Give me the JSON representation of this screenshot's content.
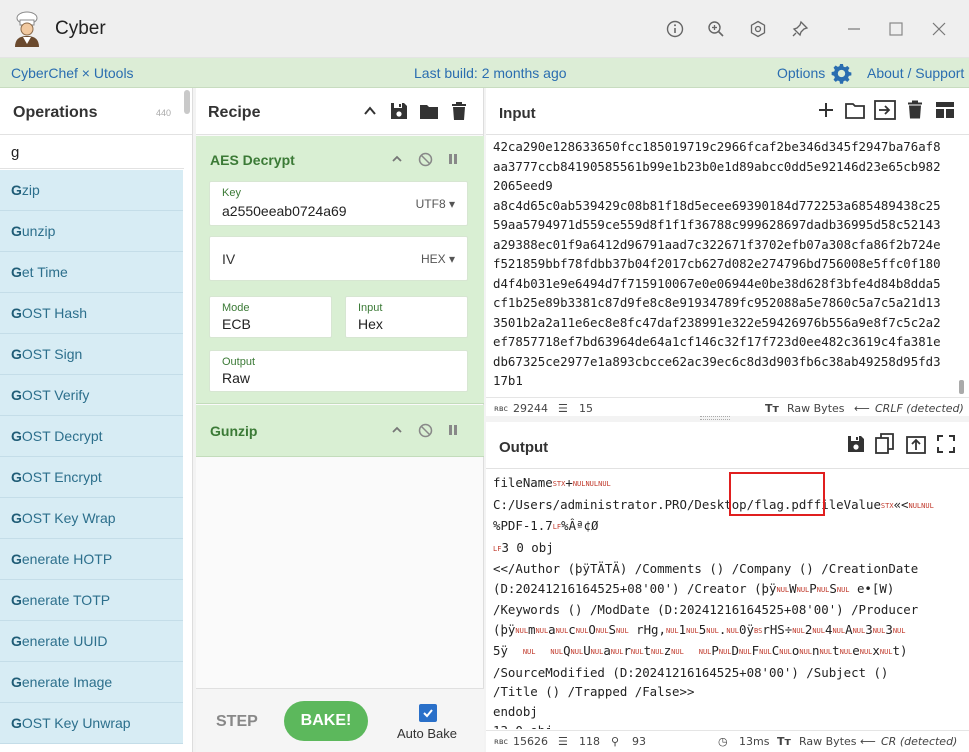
{
  "window": {
    "title": "Cyber"
  },
  "banner": {
    "left": "CyberChef × Utools",
    "center": "Last build: 2 months ago",
    "options": "Options",
    "about": "About / Support"
  },
  "operations": {
    "title": "Operations",
    "count": "440",
    "search_value": "g",
    "items": [
      {
        "hl": "G",
        "rest": "zip"
      },
      {
        "hl": "G",
        "rest": "unzip"
      },
      {
        "hl": "G",
        "rest": "et Time"
      },
      {
        "hl": "G",
        "rest": "OST Hash"
      },
      {
        "hl": "G",
        "rest": "OST Sign"
      },
      {
        "hl": "G",
        "rest": "OST Verify"
      },
      {
        "hl": "G",
        "rest": "OST Decrypt"
      },
      {
        "hl": "G",
        "rest": "OST Encrypt"
      },
      {
        "hl": "G",
        "rest": "OST Key Wrap"
      },
      {
        "hl": "G",
        "rest": "enerate HOTP"
      },
      {
        "hl": "G",
        "rest": "enerate TOTP"
      },
      {
        "hl": "G",
        "rest": "enerate UUID"
      },
      {
        "hl": "G",
        "rest": "enerate Image"
      },
      {
        "hl": "G",
        "rest": "OST Key Unwrap"
      }
    ]
  },
  "recipe": {
    "title": "Recipe",
    "aes": {
      "name": "AES Decrypt",
      "key_label": "Key",
      "key_value": "a2550eeab0724a69",
      "key_encoding": "UTF8",
      "iv_label": "IV",
      "iv_encoding": "HEX",
      "mode_label": "Mode",
      "mode_value": "ECB",
      "input_label": "Input",
      "input_value": "Hex",
      "output_label": "Output",
      "output_value": "Raw"
    },
    "gunzip": {
      "name": "Gunzip"
    },
    "step": "STEP",
    "bake": "BAKE!",
    "auto_bake": "Auto Bake"
  },
  "input": {
    "title": "Input",
    "lines": [
      "42ca290e128633650fcc185019719c2966fcaf2be346d345f2947ba76af8",
      "aa3777ccb84190585561b99e1b23b0e1d89abcc0dd5e92146d23e65cb982",
      "2065eed9",
      "a8c4d65c0ab539429c08b81f18d5ecee69390184d772253a685489438c25",
      "59aa5794971d559ce559d8f1f1f36788c999628697dadb36995d58c52143",
      "a29388ec01f9a6412d96791aad7c322671f3702efb07a308cfa86f2b724e",
      "f521859bbf78fdbb37b04f2017cb627d082e274796bd756008e5ffc0f180",
      "d4f4b031e9e6494d7f715910067e0e06944e0be38d628f3bfe4d84b8dda5",
      "cf1b25e89b3381c87d9fe8c8e91934789fc952088a5e7860c5a7c5a21d13",
      "3501b2a2a11e6ec8e8fc47daf238991e322e59426976b556a9e8f7c5c2a2",
      "ef7857718ef7bd63964de64a1cf146c32f17f723d0ee482c3619c4fa381e",
      "db67325ce2977e1a893cbcce62ac39ec6c8d3d903fb6c38ab49258d95fd3",
      "17b1"
    ],
    "status": {
      "rbc_label": "ʀʙᴄ",
      "chars": "29244",
      "lines": "15",
      "raw_bytes": "Raw Bytes",
      "eol": "CRLF (detected)"
    }
  },
  "output": {
    "title": "Output",
    "lines": [
      [
        {
          "t": "fileName"
        },
        {
          "c": "STX"
        },
        {
          "t": "+"
        },
        {
          "c": "NUL"
        },
        {
          "c": "NUL"
        },
        {
          "c": "NUL"
        }
      ],
      [
        {
          "t": "C:/Users/administrator.PRO/Desktop/flag.pdffileValue"
        },
        {
          "c": "STX"
        },
        {
          "t": "«<"
        },
        {
          "c": "NUL"
        },
        {
          "c": "NUL"
        }
      ],
      [
        {
          "t": "%PDF-1.7"
        },
        {
          "c": "LF"
        },
        {
          "t": "%Âª¢Ø"
        }
      ],
      [
        {
          "c": "LF"
        },
        {
          "t": "3 0 obj"
        }
      ],
      [
        {
          "t": "<</Author (þÿTÄTÄ) /Comments () /Company () /CreationDate"
        }
      ],
      [
        {
          "t": "(D:20241216164525+08'00') /Creator (þÿ"
        },
        {
          "c": "NUL"
        },
        {
          "t": "W"
        },
        {
          "c": "NUL"
        },
        {
          "t": "P"
        },
        {
          "c": "NUL"
        },
        {
          "t": "S"
        },
        {
          "c": "NUL"
        },
        {
          "t": " e•[W)"
        }
      ],
      [
        {
          "t": "/Keywords () /ModDate (D:20241216164525+08'00') /Producer"
        }
      ],
      [
        {
          "t": "(þÿ"
        },
        {
          "c": "NUL"
        },
        {
          "t": "m"
        },
        {
          "c": "NUL"
        },
        {
          "t": "a"
        },
        {
          "c": "NUL"
        },
        {
          "t": "c"
        },
        {
          "c": "NUL"
        },
        {
          "t": "O"
        },
        {
          "c": "NUL"
        },
        {
          "t": "S"
        },
        {
          "c": "NUL"
        },
        {
          "t": " rHg,"
        },
        {
          "c": "NUL"
        },
        {
          "t": "1"
        },
        {
          "c": "NUL"
        },
        {
          "t": "5"
        },
        {
          "c": "NUL"
        },
        {
          "t": "."
        },
        {
          "c": "NUL"
        },
        {
          "t": "0ÿ"
        },
        {
          "c": "BS"
        },
        {
          "t": "rHS÷"
        },
        {
          "c": "NUL"
        },
        {
          "t": "2"
        },
        {
          "c": "NUL"
        },
        {
          "t": "4"
        },
        {
          "c": "NUL"
        },
        {
          "t": "A"
        },
        {
          "c": "NUL"
        },
        {
          "t": "3"
        },
        {
          "c": "NUL"
        },
        {
          "t": "3"
        },
        {
          "c": "NUL"
        }
      ],
      [
        {
          "t": "5ÿ  "
        },
        {
          "c": "NUL"
        },
        {
          "t": "  "
        },
        {
          "c": "NUL"
        },
        {
          "t": "Q"
        },
        {
          "c": "NUL"
        },
        {
          "t": "U"
        },
        {
          "c": "NUL"
        },
        {
          "t": "a"
        },
        {
          "c": "NUL"
        },
        {
          "t": "r"
        },
        {
          "c": "NUL"
        },
        {
          "t": "t"
        },
        {
          "c": "NUL"
        },
        {
          "t": "z"
        },
        {
          "c": "NUL"
        },
        {
          "t": "  "
        },
        {
          "c": "NUL"
        },
        {
          "t": "P"
        },
        {
          "c": "NUL"
        },
        {
          "t": "D"
        },
        {
          "c": "NUL"
        },
        {
          "t": "F"
        },
        {
          "c": "NUL"
        },
        {
          "t": "C"
        },
        {
          "c": "NUL"
        },
        {
          "t": "o"
        },
        {
          "c": "NUL"
        },
        {
          "t": "n"
        },
        {
          "c": "NUL"
        },
        {
          "t": "t"
        },
        {
          "c": "NUL"
        },
        {
          "t": "e"
        },
        {
          "c": "NUL"
        },
        {
          "t": "x"
        },
        {
          "c": "NUL"
        },
        {
          "t": "t)"
        }
      ],
      [
        {
          "t": "/SourceModified (D:20241216164525+08'00') /Subject ()"
        }
      ],
      [
        {
          "t": "/Title () /Trapped /False>>"
        }
      ],
      [
        {
          "t": "endobj"
        }
      ],
      [
        {
          "t": "13 0 obj"
        }
      ]
    ],
    "status": {
      "rbc_label": "ʀʙᴄ",
      "chars": "15626",
      "lines": "118",
      "position": "93",
      "time": "13ms",
      "raw_bytes": "Raw Bytes",
      "eol": "CR (detected)"
    }
  }
}
